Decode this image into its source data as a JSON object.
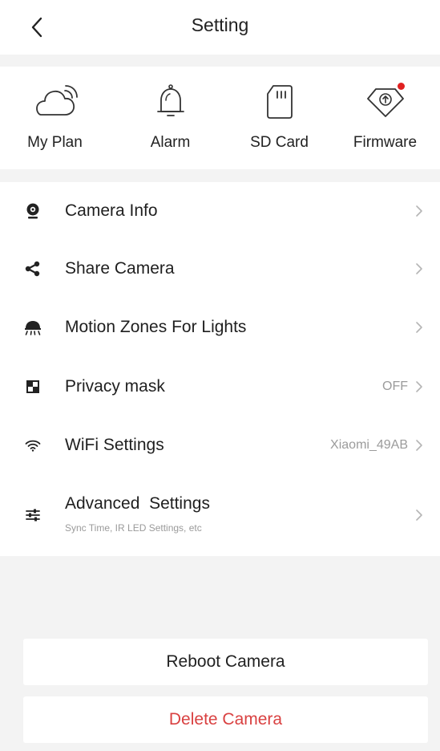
{
  "header": {
    "title": "Setting",
    "back_icon": "chevron-left-icon"
  },
  "quick_actions": [
    {
      "label": "My Plan",
      "icon": "cloud-icon"
    },
    {
      "label": "Alarm",
      "icon": "bell-icon"
    },
    {
      "label": "SD Card",
      "icon": "sd-card-icon"
    },
    {
      "label": "Firmware",
      "icon": "firmware-update-icon",
      "badge": true
    }
  ],
  "menu": {
    "items": [
      {
        "label": "Camera Info",
        "icon": "camera-icon",
        "value": "",
        "subtitle": ""
      },
      {
        "label": "Share Camera",
        "icon": "share-icon",
        "value": "",
        "subtitle": ""
      },
      {
        "label": "Motion Zones For Lights",
        "icon": "lamp-icon",
        "value": "",
        "subtitle": ""
      },
      {
        "label": "Privacy mask",
        "icon": "privacy-mask-icon",
        "value": "OFF",
        "subtitle": ""
      },
      {
        "label": "WiFi Settings",
        "icon": "wifi-icon",
        "value": "Xiaomi_49AB",
        "subtitle": ""
      },
      {
        "label": "Advanced  Settings",
        "icon": "sliders-icon",
        "value": "",
        "subtitle": "Sync Time, IR LED Settings, etc"
      }
    ]
  },
  "actions": {
    "reboot_label": "Reboot Camera",
    "delete_label": "Delete Camera"
  },
  "colors": {
    "background": "#f3f3f3",
    "danger": "#d94141",
    "badge": "#e02020",
    "secondary_text": "#9b9b9b"
  }
}
